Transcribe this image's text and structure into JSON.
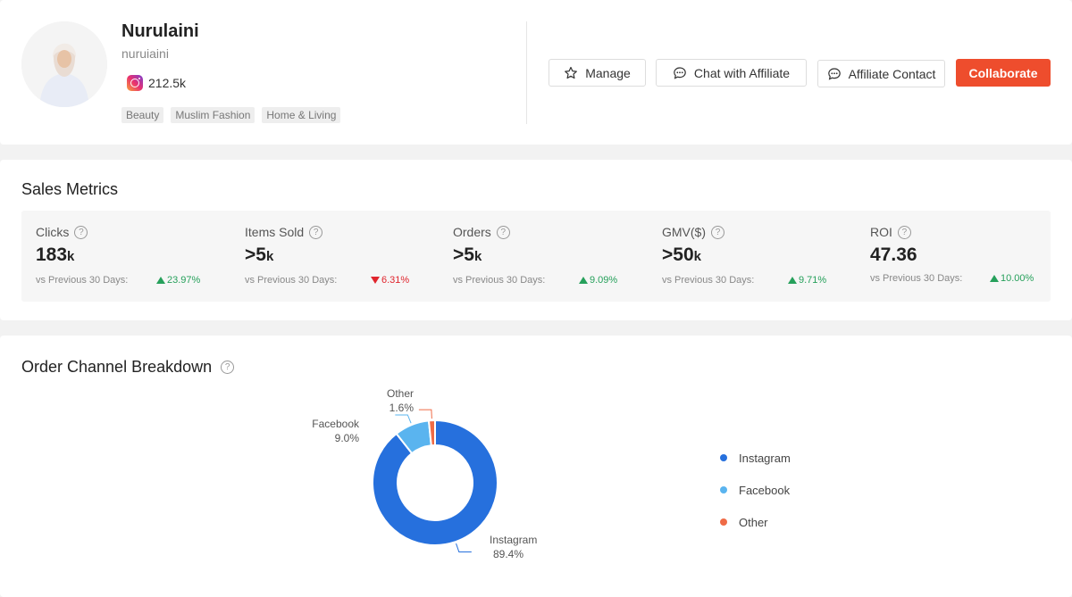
{
  "profile": {
    "name": "Nurulaini",
    "handle": "nuruiaini",
    "instagram_followers": "212.5k",
    "tags": [
      "Beauty",
      "Muslim Fashion",
      "Home & Living"
    ]
  },
  "actions": {
    "manage": "Manage",
    "chat": "Chat with Affiliate",
    "contact": "Affiliate Contact",
    "collaborate": "Collaborate"
  },
  "metrics": {
    "title": "Sales Metrics",
    "compare_label": "vs Previous 30 Days:",
    "items": [
      {
        "label": "Clicks",
        "value": "183",
        "unit": "k",
        "change": "23.97%",
        "direction": "up"
      },
      {
        "label": "Items Sold",
        "value": ">5",
        "unit": "k",
        "change": "6.31%",
        "direction": "down"
      },
      {
        "label": "Orders",
        "value": ">5",
        "unit": "k",
        "change": "9.09%",
        "direction": "up"
      },
      {
        "label": "GMV($)",
        "value": ">50",
        "unit": "k",
        "change": "9.71%",
        "direction": "up"
      },
      {
        "label": "ROI",
        "value": "47.36",
        "unit": "",
        "change": "10.00%",
        "direction": "up"
      }
    ]
  },
  "breakdown": {
    "title": "Order Channel Breakdown"
  },
  "colors": {
    "accent": "#ee4d2d",
    "positive": "#26a05b",
    "negative": "#e0252d"
  },
  "chart_data": {
    "type": "pie",
    "style": "donut",
    "categories": [
      "Instagram",
      "Facebook",
      "Other"
    ],
    "values": [
      89.4,
      9.0,
      1.6
    ],
    "labels": [
      "89.4%",
      "9.0%",
      "1.6%"
    ],
    "colors": [
      "#2670dd",
      "#5ab4ef",
      "#ef6b46"
    ],
    "legend": "right"
  }
}
